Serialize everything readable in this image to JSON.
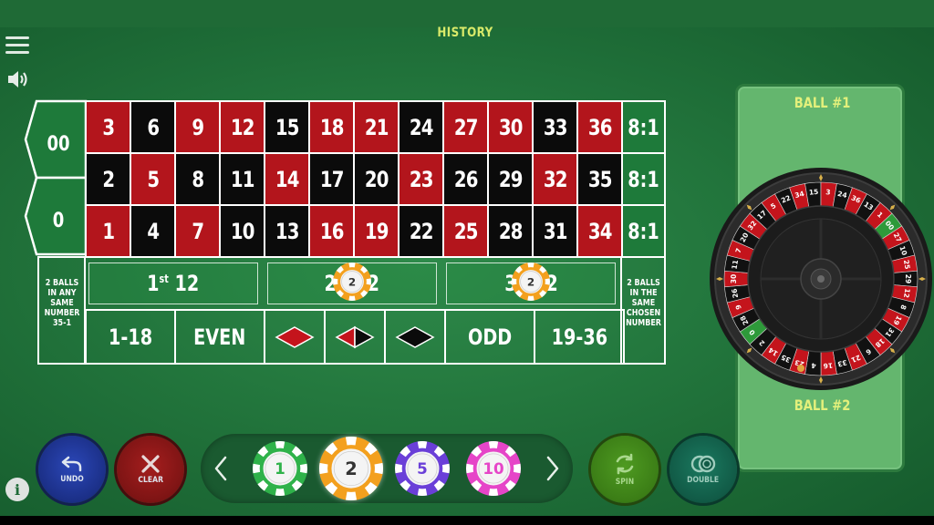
{
  "header": {
    "history_label": "HISTORY"
  },
  "table": {
    "zero_cells": [
      "00",
      "0"
    ],
    "rows": [
      [
        {
          "n": "3",
          "c": "red"
        },
        {
          "n": "6",
          "c": "black"
        },
        {
          "n": "9",
          "c": "red"
        },
        {
          "n": "12",
          "c": "red"
        },
        {
          "n": "15",
          "c": "black"
        },
        {
          "n": "18",
          "c": "red"
        },
        {
          "n": "21",
          "c": "red"
        },
        {
          "n": "24",
          "c": "black"
        },
        {
          "n": "27",
          "c": "red"
        },
        {
          "n": "30",
          "c": "red"
        },
        {
          "n": "33",
          "c": "black"
        },
        {
          "n": "36",
          "c": "red"
        }
      ],
      [
        {
          "n": "2",
          "c": "black"
        },
        {
          "n": "5",
          "c": "red"
        },
        {
          "n": "8",
          "c": "black"
        },
        {
          "n": "11",
          "c": "black"
        },
        {
          "n": "14",
          "c": "red"
        },
        {
          "n": "17",
          "c": "black"
        },
        {
          "n": "20",
          "c": "black"
        },
        {
          "n": "23",
          "c": "red"
        },
        {
          "n": "26",
          "c": "black"
        },
        {
          "n": "29",
          "c": "black"
        },
        {
          "n": "32",
          "c": "red"
        },
        {
          "n": "35",
          "c": "black"
        }
      ],
      [
        {
          "n": "1",
          "c": "red"
        },
        {
          "n": "4",
          "c": "black"
        },
        {
          "n": "7",
          "c": "red"
        },
        {
          "n": "10",
          "c": "black"
        },
        {
          "n": "13",
          "c": "black"
        },
        {
          "n": "16",
          "c": "red"
        },
        {
          "n": "19",
          "c": "red"
        },
        {
          "n": "22",
          "c": "black"
        },
        {
          "n": "25",
          "c": "red"
        },
        {
          "n": "28",
          "c": "black"
        },
        {
          "n": "31",
          "c": "black"
        },
        {
          "n": "34",
          "c": "red"
        }
      ]
    ],
    "column_bets": [
      "8:1",
      "8:1",
      "8:1"
    ],
    "dozens": [
      {
        "label": "1",
        "suffix": "st",
        "tail": " 12"
      },
      {
        "label": "2",
        "suffix": "nd",
        "tail": " 12"
      },
      {
        "label": "3",
        "suffix": "rd",
        "tail": " 12"
      }
    ],
    "outside_bets": [
      "1-18",
      "EVEN",
      "",
      "",
      "",
      "ODD",
      "19-36"
    ],
    "left_side_text": "2 BALLS IN ANY SAME NUMBER 35-1",
    "right_side_text": "2 BALLS IN THE SAME CHOSEN NUMBER",
    "placed_chips": [
      {
        "bet": "2nd 12",
        "value": "2"
      },
      {
        "bet": "3rd 12",
        "value": "2"
      }
    ]
  },
  "ball_panel": {
    "ball1_label": "BALL #1",
    "ball2_label": "BALL #2"
  },
  "wheel": {
    "sequence": [
      "0",
      "28",
      "9",
      "26",
      "30",
      "11",
      "7",
      "20",
      "32",
      "17",
      "5",
      "22",
      "34",
      "15",
      "3",
      "24",
      "36",
      "13",
      "1",
      "00",
      "27",
      "10",
      "25",
      "29",
      "12",
      "8",
      "19",
      "31",
      "18",
      "6",
      "21",
      "33",
      "16",
      "4",
      "23",
      "35",
      "14",
      "2"
    ],
    "colors": {
      "red": "#c4141c",
      "black": "#111111",
      "green": "#2e9a3a"
    }
  },
  "controls": {
    "undo_label": "UNDO",
    "clear_label": "CLEAR",
    "spin_label": "SPIN",
    "double_label": "DOUBLE"
  },
  "chips": [
    {
      "value": "1",
      "color": "#2fb24a",
      "selected": false
    },
    {
      "value": "2",
      "color": "#f3a01e",
      "selected": true
    },
    {
      "value": "5",
      "color": "#6a3fd8",
      "selected": false
    },
    {
      "value": "10",
      "color": "#e645c8",
      "selected": false
    }
  ],
  "icons": [
    "menu-icon",
    "sound-icon",
    "undo-icon",
    "clear-icon",
    "spin-icon",
    "double-icon",
    "chevron-left-icon",
    "chevron-right-icon",
    "info-icon"
  ]
}
